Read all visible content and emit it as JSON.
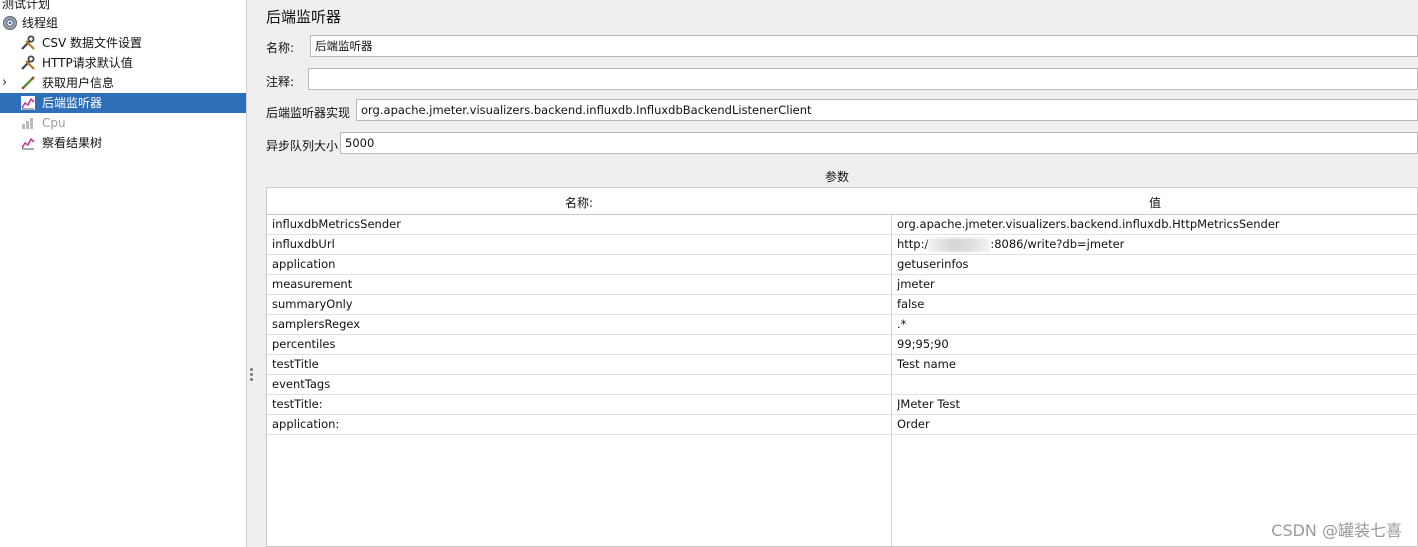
{
  "tree": {
    "items": [
      {
        "label": "测试计划",
        "icon": "test-plan-icon"
      },
      {
        "label": "线程组",
        "icon": "gear-icon"
      },
      {
        "label": "CSV 数据文件设置",
        "icon": "wrench-icon"
      },
      {
        "label": "HTTP请求默认值",
        "icon": "wrench-icon"
      },
      {
        "label": "获取用户信息",
        "icon": "pipette-icon"
      },
      {
        "label": "后端监听器",
        "icon": "chart-icon",
        "selected": true
      },
      {
        "label": "Cpu",
        "icon": "chart-icon",
        "disabled": true
      },
      {
        "label": "察看结果树",
        "icon": "chart-icon"
      }
    ]
  },
  "panel": {
    "title": "后端监听器",
    "name_label": "名称:",
    "name_value": "后端监听器",
    "comment_label": "注释:",
    "comment_value": "",
    "impl_label": "后端监听器实现",
    "impl_value": "org.apache.jmeter.visualizers.backend.influxdb.InfluxdbBackendListenerClient",
    "queue_label": "异步队列大小",
    "queue_value": "5000",
    "params_title": "参数",
    "table": {
      "headers": {
        "name": "名称:",
        "value": "值"
      },
      "rows": [
        {
          "name": "influxdbMetricsSender",
          "value": "org.apache.jmeter.visualizers.backend.influxdb.HttpMetricsSender"
        },
        {
          "name": "influxdbUrl",
          "value_prefix": "http:/",
          "value_suffix": ":8086/write?db=jmeter"
        },
        {
          "name": "application",
          "value": "getuserinfos"
        },
        {
          "name": "measurement",
          "value": "jmeter"
        },
        {
          "name": "summaryOnly",
          "value": "false"
        },
        {
          "name": "samplersRegex",
          "value": ".*"
        },
        {
          "name": "percentiles",
          "value": "99;95;90"
        },
        {
          "name": "testTitle",
          "value": "Test name"
        },
        {
          "name": "eventTags",
          "value": ""
        },
        {
          "name": "testTitle:",
          "value": "JMeter Test"
        },
        {
          "name": "application:",
          "value": "Order"
        }
      ]
    }
  },
  "watermark": "CSDN @罐装七喜",
  "colors": {
    "selection": "#2f6fba",
    "background": "#efefef"
  }
}
